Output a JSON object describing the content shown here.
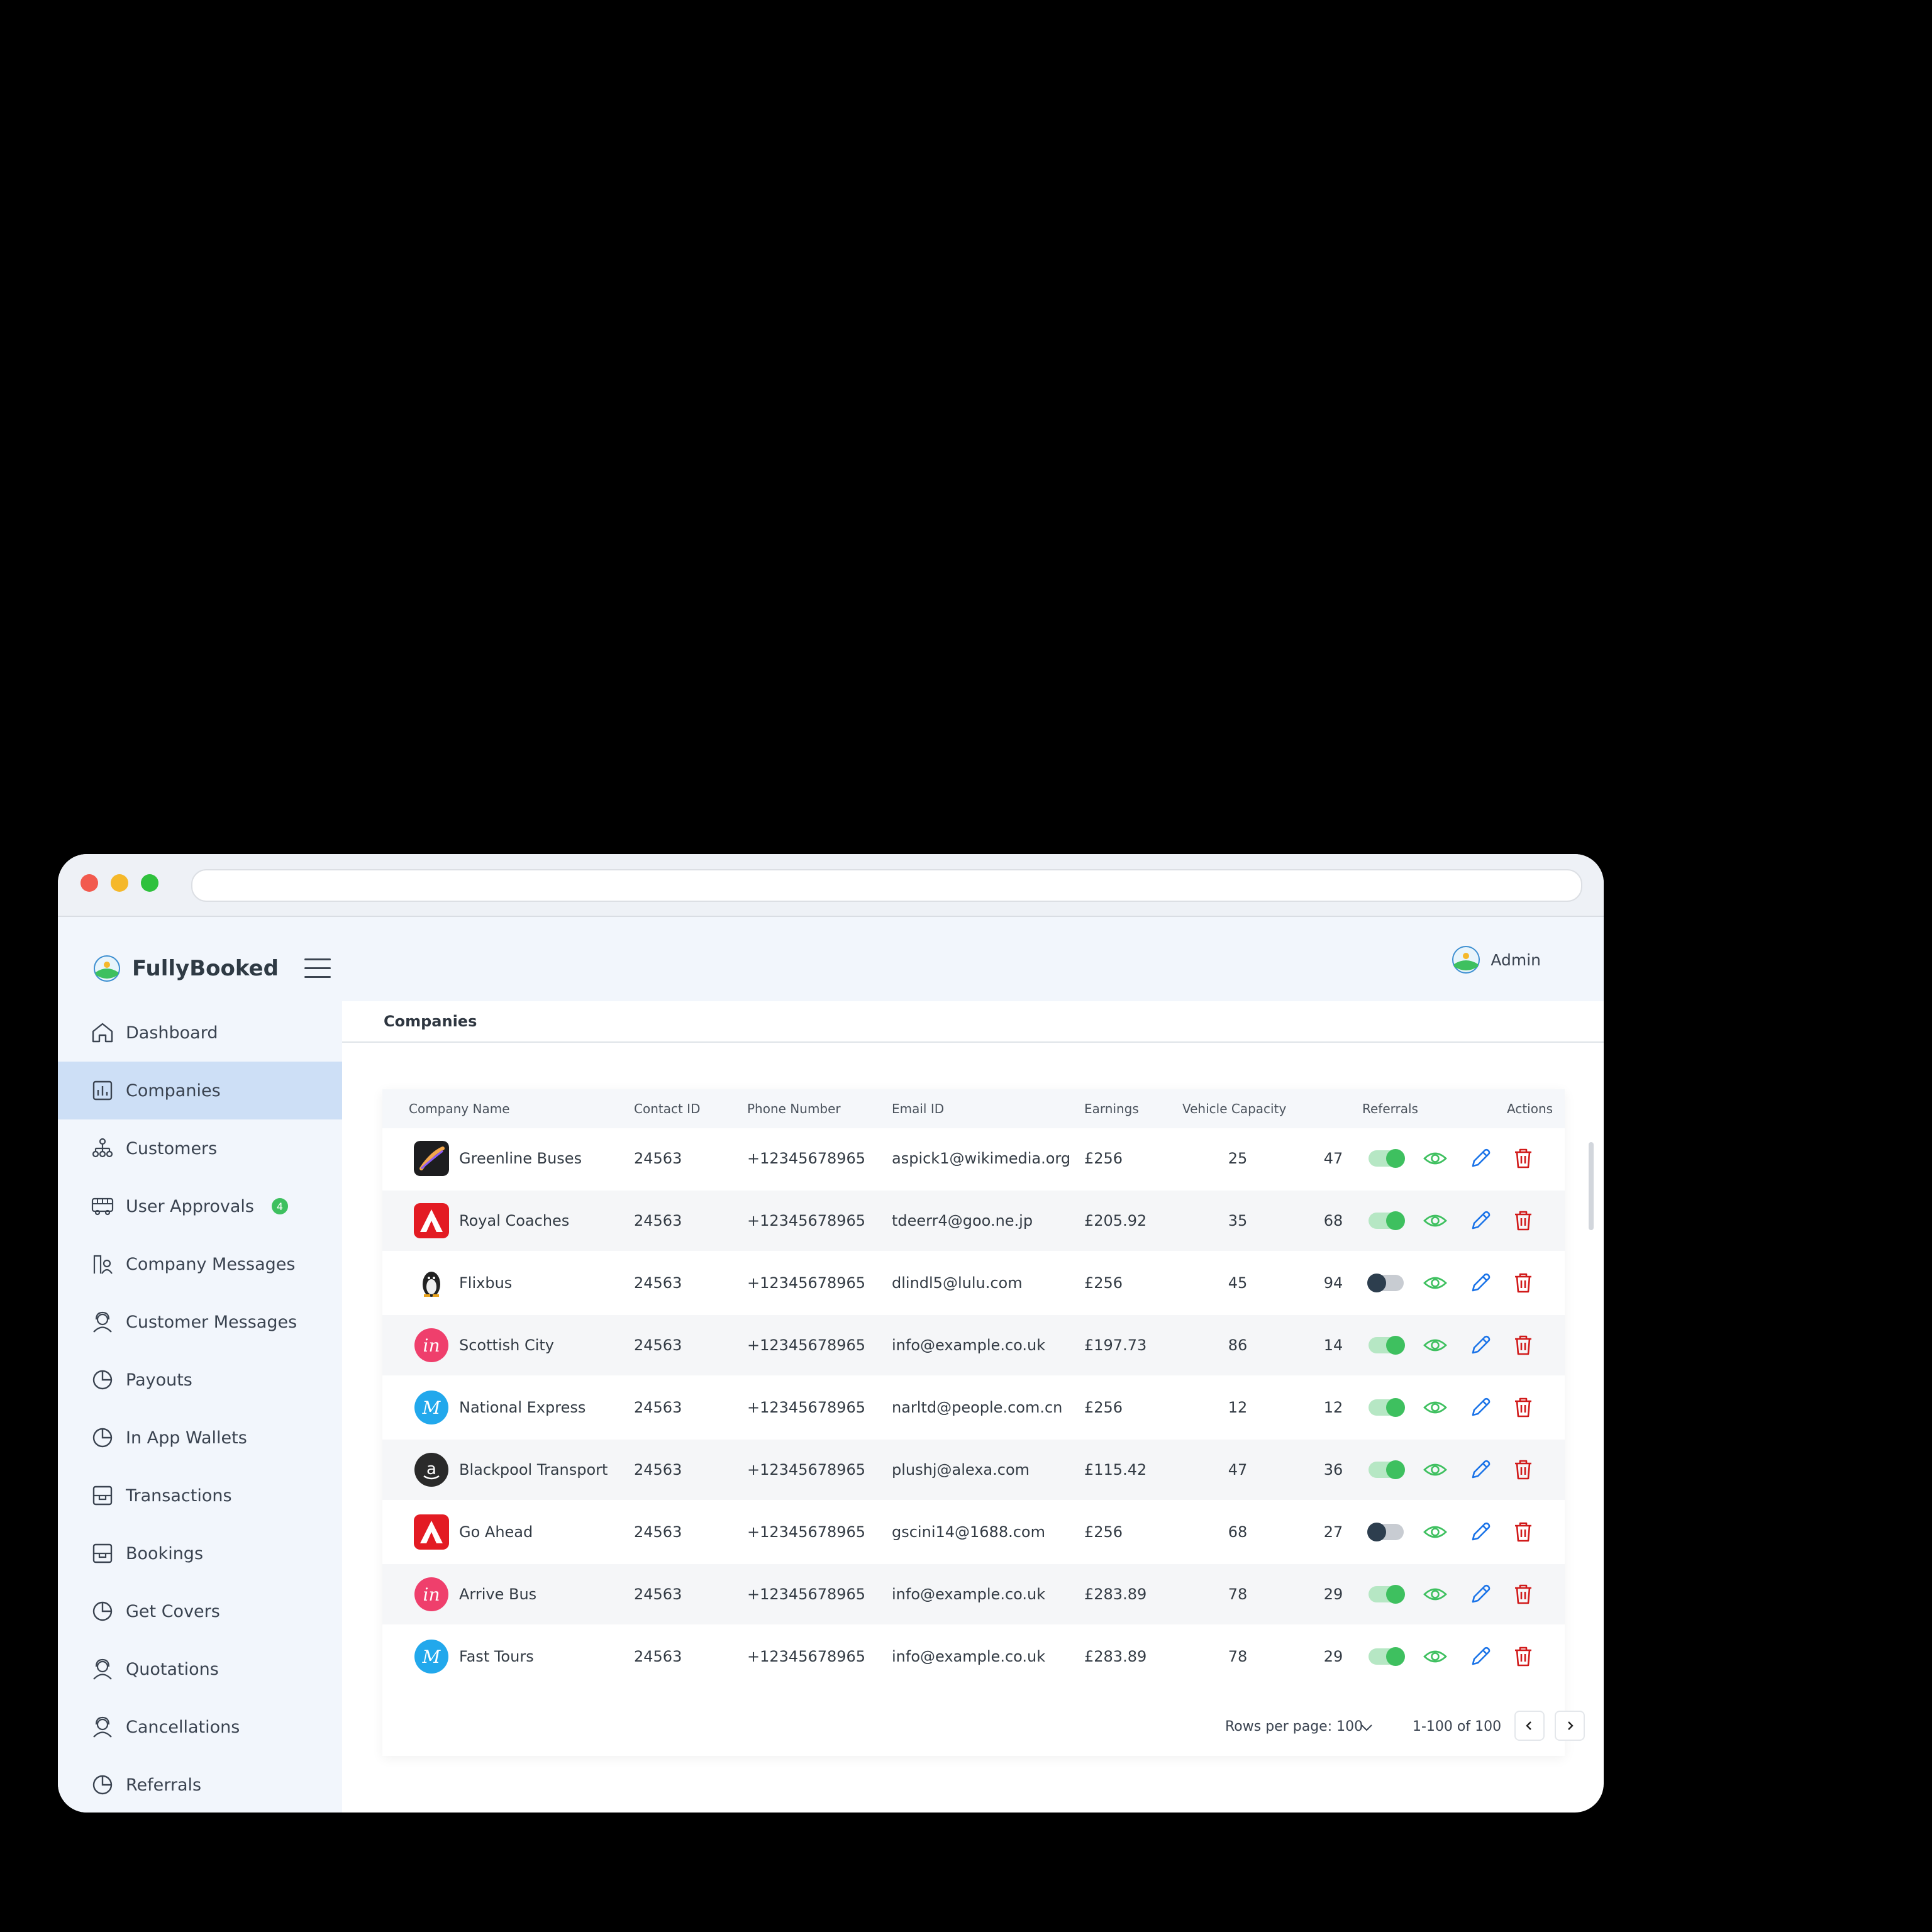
{
  "app": {
    "name": "FullyBooked",
    "user": "Admin"
  },
  "colors": {
    "accent": "#3ec05f",
    "active_nav": "#cddff6",
    "edit": "#1a73e8",
    "delete": "#d11a1a"
  },
  "nav": [
    {
      "label": "Dashboard",
      "icon": "home-icon"
    },
    {
      "label": "Companies",
      "icon": "bar-chart-icon",
      "active": true
    },
    {
      "label": "Customers",
      "icon": "org-chart-icon"
    },
    {
      "label": "User Approvals",
      "icon": "bus-icon",
      "badge": "4"
    },
    {
      "label": "Company Messages",
      "icon": "person-building-icon"
    },
    {
      "label": "Customer Messages",
      "icon": "user-headset-icon"
    },
    {
      "label": "Payouts",
      "icon": "pie-chart-icon"
    },
    {
      "label": "In App Wallets",
      "icon": "pie-chart-icon"
    },
    {
      "label": "Transactions",
      "icon": "box-icon"
    },
    {
      "label": "Bookings",
      "icon": "box-icon"
    },
    {
      "label": "Get Covers",
      "icon": "pie-chart-icon"
    },
    {
      "label": "Quotations",
      "icon": "user-headset-icon"
    },
    {
      "label": "Cancellations",
      "icon": "user-headset-icon"
    },
    {
      "label": "Referrals",
      "icon": "pie-chart-icon"
    }
  ],
  "page": {
    "title": "Companies"
  },
  "table": {
    "headers": [
      "Company Name",
      "Contact ID",
      "Phone Number",
      "Email ID",
      "Earnings",
      "Vehicle Capacity",
      "Referrals",
      "Actions"
    ],
    "rows": [
      {
        "name": "Greenline Buses",
        "contact": "24563",
        "phone": "+12345678965",
        "email": "aspick1@wikimedia.org",
        "earnings": "£256",
        "capacity": "25",
        "referrals": "47",
        "active": true,
        "logo": "procreate-logo-icon"
      },
      {
        "name": "Royal Coaches",
        "contact": "24563",
        "phone": "+12345678965",
        "email": "tdeerr4@goo.ne.jp",
        "earnings": "£205.92",
        "capacity": "35",
        "referrals": "68",
        "active": true,
        "logo": "adobe-logo-icon"
      },
      {
        "name": "Flixbus",
        "contact": "24563",
        "phone": "+12345678965",
        "email": "dlindl5@lulu.com",
        "earnings": "£256",
        "capacity": "45",
        "referrals": "94",
        "active": false,
        "logo": "linux-logo-icon"
      },
      {
        "name": "Scottish City",
        "contact": "24563",
        "phone": "+12345678965",
        "email": "info@example.co.uk",
        "earnings": "£197.73",
        "capacity": "86",
        "referrals": "14",
        "active": true,
        "logo": "invision-logo-icon"
      },
      {
        "name": "National Express",
        "contact": "24563",
        "phone": "+12345678965",
        "email": "narltd@people.com.cn",
        "earnings": "£256",
        "capacity": "12",
        "referrals": "12",
        "active": true,
        "logo": "m-logo-icon"
      },
      {
        "name": "Blackpool Transport",
        "contact": "24563",
        "phone": "+12345678965",
        "email": "plushj@alexa.com",
        "earnings": "£115.42",
        "capacity": "47",
        "referrals": "36",
        "active": true,
        "logo": "amazon-logo-icon"
      },
      {
        "name": "Go Ahead",
        "contact": "24563",
        "phone": "+12345678965",
        "email": "gscini14@1688.com",
        "earnings": "£256",
        "capacity": "68",
        "referrals": "27",
        "active": false,
        "logo": "adobe-logo-icon"
      },
      {
        "name": "Arrive Bus",
        "contact": "24563",
        "phone": "+12345678965",
        "email": "info@example.co.uk",
        "earnings": "£283.89",
        "capacity": "78",
        "referrals": "29",
        "active": true,
        "logo": "invision-logo-icon"
      },
      {
        "name": "Fast Tours",
        "contact": "24563",
        "phone": "+12345678965",
        "email": "info@example.co.uk",
        "earnings": "£283.89",
        "capacity": "78",
        "referrals": "29",
        "active": true,
        "logo": "m-logo-icon"
      }
    ]
  },
  "pagination": {
    "rows_per_page": "Rows per page: 100",
    "range": "1-100 of 100"
  }
}
